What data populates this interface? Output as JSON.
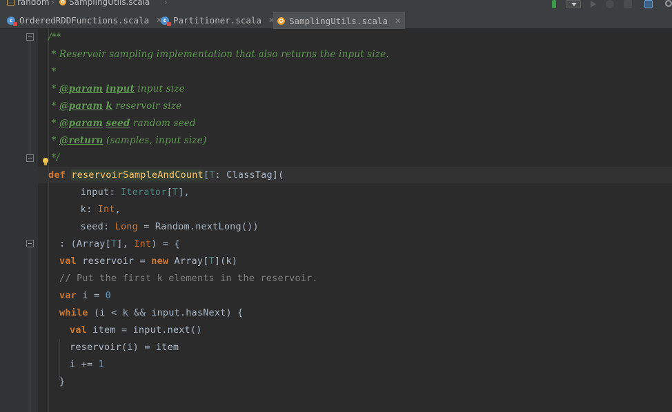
{
  "breadcrumb": {
    "items": [
      {
        "label": "random",
        "icon": "folder-icon"
      },
      {
        "label": "SamplingUtils.scala",
        "icon": "scala-object-icon"
      }
    ]
  },
  "toolbar": {
    "icons": [
      "run-config-dropdown",
      "run-icon",
      "debug-icon",
      "coverage-icon",
      "structure-icon"
    ]
  },
  "tabs": [
    {
      "label": "OrderedRDDFunctions.scala",
      "icon": "scala-class-icon",
      "active": false
    },
    {
      "label": "Partitioner.scala",
      "icon": "scala-class-icon",
      "active": false
    },
    {
      "label": "SamplingUtils.scala",
      "icon": "scala-object-icon",
      "active": true
    }
  ],
  "code": {
    "l1": "/**",
    "l2": " * Reservoir sampling implementation that also returns the input size.",
    "l3": " *",
    "l4_star": " * ",
    "l4_tag": "@param",
    "l4_name": "input",
    "l4_desc": " input size",
    "l5_star": " * ",
    "l5_tag": "@param",
    "l5_name": "k",
    "l5_desc": " reservoir size",
    "l6_star": " * ",
    "l6_tag": "@param",
    "l6_name": "seed",
    "l6_desc": " random seed",
    "l7_star": " * ",
    "l7_tag": "@return",
    "l7_desc": " (samples, input size)",
    "l8": " */",
    "l9_kw": "def",
    "l9_fn": "reservoirSampleAndCount",
    "l9_a": "[",
    "l9_t": "T",
    "l9_b": ": ClassTag](",
    "l10_a": "  input: ",
    "l10_type": "Iterator",
    "l10_b": "[",
    "l10_t": "T",
    "l10_c": "],",
    "l11_a": "  k: ",
    "l11_type": "Int",
    "l11_b": ",",
    "l12_a": "  seed: ",
    "l12_type": "Long",
    "l12_b": " = Random.nextLong())",
    "l13_a": ": (Array[",
    "l13_t": "T",
    "l13_b": "], ",
    "l13_type": "Int",
    "l13_c": ") = {",
    "l14_kw": "val",
    "l14_a": " reservoir = ",
    "l14_kw2": "new",
    "l14_b": " Array[",
    "l14_t": "T",
    "l14_c": "](k)",
    "l15": "// Put the first k elements in the reservoir.",
    "l16_kw": "var",
    "l16_a": " i = ",
    "l16_num": "0",
    "l17_kw": "while",
    "l17_a": " (i < k && input.hasNext) {",
    "l18_kw": "val",
    "l18_a": " item = input.next()",
    "l19": "reservoir(i) = item",
    "l20_a": "i += ",
    "l20_num": "1",
    "l21": "}"
  }
}
